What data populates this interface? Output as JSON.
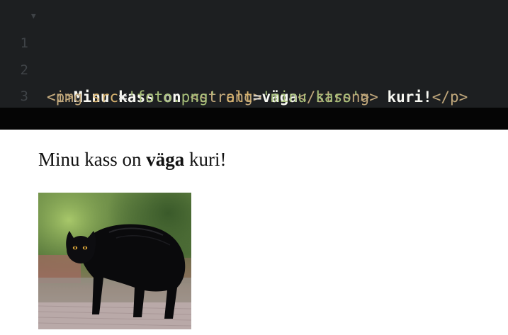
{
  "editor": {
    "lines": [
      {
        "number": "1",
        "fold_marker": "▼",
        "tokens": {
          "p_open": "<p>",
          "text_before": "Minu kass on ",
          "strong_open": "<strong>",
          "strong_text": "väga",
          "strong_close": "</strong>",
          "text_after": " kuri!",
          "p_close": "</p>"
        }
      },
      {
        "number": "2",
        "tokens": {
          "img_open": "<img ",
          "attr_src": "src",
          "eq1": "=",
          "src_value": "'foto.png'",
          "space": " ",
          "attr_alt": "alt",
          "eq2": "=",
          "alt_value": "'minu kass'",
          "img_close": ">"
        }
      },
      {
        "number": "3"
      }
    ]
  },
  "preview": {
    "paragraph": {
      "before": "Minu kass on ",
      "strong": "väga",
      "after": " kuri!"
    },
    "image": {
      "alt": "minu kass",
      "icon": "black-cat-photo"
    }
  },
  "colors": {
    "editor_bg": "#1d1f21",
    "divider_bg": "#050505",
    "tag": "#c0a77b",
    "attr": "#d7b26e",
    "string": "#a8c07a",
    "text": "#f8f8f2",
    "gutter": "#3f4347"
  }
}
